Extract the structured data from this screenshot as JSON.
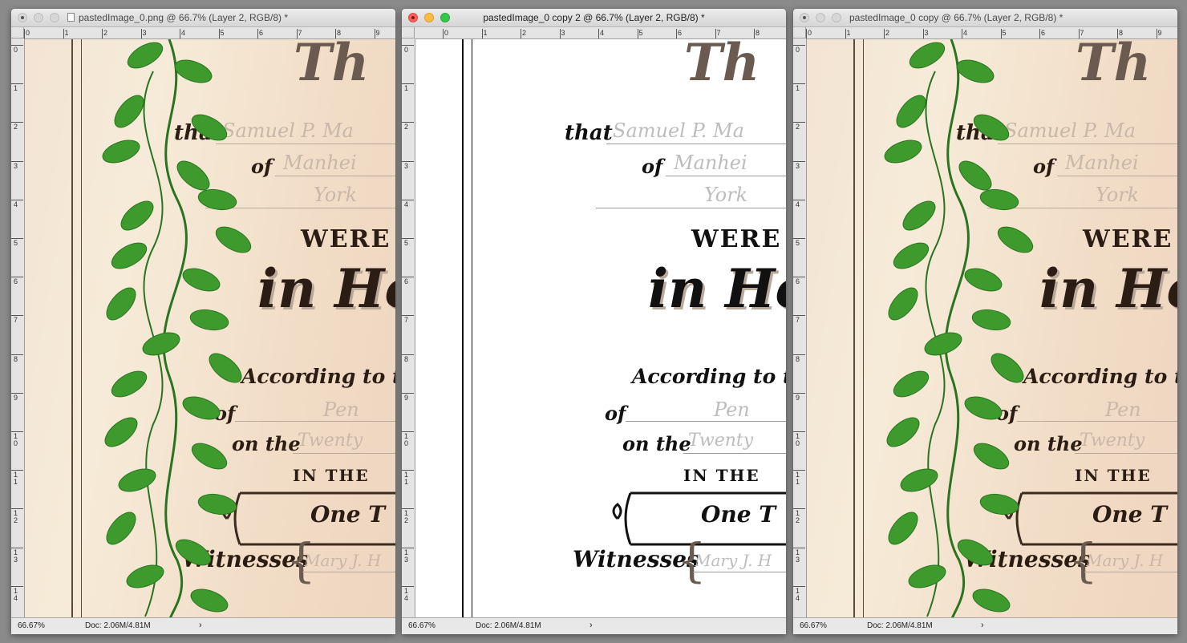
{
  "windows": [
    {
      "id": "win-1",
      "title": "pastedImage_0.png @ 66.7% (Layer 2, RGB/8) *",
      "active": false,
      "variant": "aged-with-vines",
      "zoom": "66.67%",
      "doc_size": "Doc: 2.06M/4.81M",
      "status_arrow": "›"
    },
    {
      "id": "win-2",
      "title": "pastedImage_0 copy 2 @ 66.7% (Layer 2, RGB/8) *",
      "active": true,
      "variant": "white-lineart",
      "zoom": "66.67%",
      "doc_size": "Doc: 2.06M/4.81M",
      "status_arrow": "›"
    },
    {
      "id": "win-3",
      "title": "pastedImage_0 copy @ 66.7% (Layer 2, RGB/8) *",
      "active": false,
      "variant": "aged-with-vines",
      "zoom": "66.67%",
      "doc_size": "Doc: 2.06M/4.81M",
      "status_arrow": "›"
    }
  ],
  "ruler": {
    "top_labels": [
      "0",
      "1",
      "2",
      "3",
      "4",
      "5",
      "6",
      "7",
      "8",
      "9"
    ],
    "left_labels": [
      "0",
      "1",
      "2",
      "3",
      "4",
      "5",
      "6",
      "7",
      "8",
      "9",
      "1 0",
      "1 1",
      "1 2",
      "1 3",
      "1 4"
    ]
  },
  "certificate": {
    "heading_fragment": "Th",
    "that": "that",
    "of_1": "of",
    "were": "WERE",
    "in_holy": "in Hol",
    "according": "According to the",
    "of_2": "of",
    "on_the": "on the",
    "in_the": "IN THE",
    "one_t": "One T",
    "witnesses": "Witnesses",
    "handwritten": {
      "name": "Samuel P. Ma",
      "place": "Manhei",
      "county": "York",
      "state": "Pen",
      "date": "Twenty",
      "witness": "Mary J. H"
    }
  },
  "colors": {
    "leaf": "#3f9a2e",
    "leaf_dark": "#2a7420",
    "ink": "#2b1c14"
  }
}
